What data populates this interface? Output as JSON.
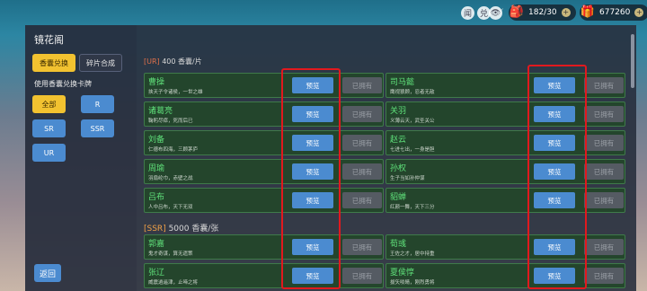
{
  "topbar": {
    "icons": [
      "闻",
      "兑",
      "eye-icon"
    ],
    "resources": [
      {
        "icon": "pouch-icon",
        "value": "182/30"
      },
      {
        "icon": "gift-bag-icon",
        "value": "677260"
      }
    ]
  },
  "left": {
    "title": "镜花阁",
    "tabs": [
      "香囊兑换",
      "碎片合成"
    ],
    "subtitle": "使用香囊兑换卡牌",
    "filters": [
      "全部",
      "R",
      "SR",
      "SSR",
      "UR"
    ],
    "back": "返回"
  },
  "main": {
    "ur_tag": "[UR]",
    "ur_price": "400 香囊/片",
    "ssr_tag": "[SSR]",
    "ssr_price": "5000 香囊/张",
    "preview_label": "预览",
    "owned_label": "已拥有",
    "cards": [
      {
        "name": "曹操",
        "desc": "挟天子令诸侯，一世之雄"
      },
      {
        "name": "司马懿",
        "desc": "鹰视狼顾，忍者无敌"
      },
      {
        "name": "诸葛亮",
        "desc": "鞠躬尽瘁，死而后已"
      },
      {
        "name": "关羽",
        "desc": "义薄云天，武圣关公"
      },
      {
        "name": "刘备",
        "desc": "仁德布四海，三顾茅庐"
      },
      {
        "name": "赵云",
        "desc": "七进七出，一身是胆"
      },
      {
        "name": "周瑜",
        "desc": "羽扇纶巾，赤壁之战"
      },
      {
        "name": "孙权",
        "desc": "生子当如孙仲谋"
      },
      {
        "name": "吕布",
        "desc": "人中吕布，天下无双"
      },
      {
        "name": "貂蝉",
        "desc": "红颜一舞，天下三分"
      },
      {
        "name": "郭嘉",
        "desc": "鬼才奇谋，算无遗策"
      },
      {
        "name": "荀彧",
        "desc": "王佐之才，居中持重"
      },
      {
        "name": "张辽",
        "desc": "威震逍遥津，止啼之将"
      },
      {
        "name": "夏侯惇",
        "desc": "拔矢啖睛，刚烈勇将"
      }
    ]
  },
  "colors": {
    "accent_yellow": "#f2c230",
    "button_blue": "#4b8bd0",
    "card_green": "#5fe07a",
    "highlight_red": "#e1191e"
  }
}
